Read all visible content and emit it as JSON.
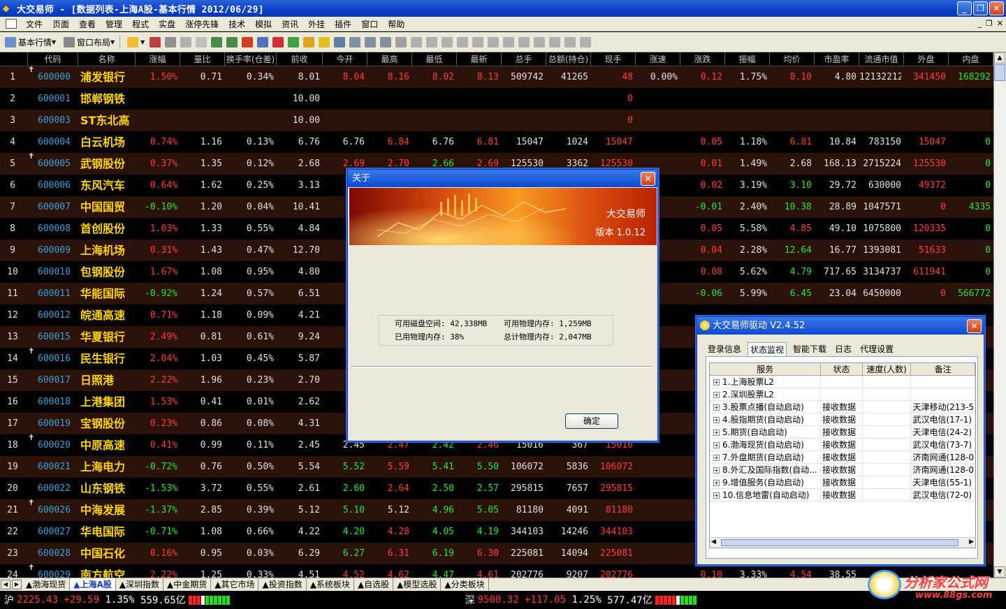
{
  "window": {
    "title": "大交易师 - [数据列表-上海A股-基本行情 2012/06/29]"
  },
  "menu": [
    "文件",
    "页面",
    "查看",
    "管理",
    "程式",
    "实盘",
    "涨停先锋",
    "技术",
    "模拟",
    "资讯",
    "外挂",
    "插件",
    "窗口",
    "帮助"
  ],
  "toolbar": {
    "basic_quote": "基本行情",
    "window_layout": "窗口布局"
  },
  "columns": [
    "",
    "代码",
    "名称",
    "涨幅",
    "量比",
    "换手率(仓差)",
    "前收",
    "今开",
    "最高",
    "最低",
    "最新",
    "总手",
    "总额(持仓)",
    "现手",
    "涨速",
    "涨跌",
    "振幅",
    "均价",
    "市盈率",
    "流通市值",
    "外盘",
    "内盘"
  ],
  "rows": [
    {
      "n": "1",
      "pin": true,
      "code": "600000",
      "name": "浦发银行",
      "chg": "1.50%",
      "vr": "0.71",
      "tr": "0.34%",
      "pc": "8.01",
      "op": "8.04",
      "hi": "8.16",
      "lo": "8.02",
      "la": "8.13",
      "vol": "509742",
      "amt": "41265",
      "cur": "48",
      "spd": "0.00%",
      "d": "0.12",
      "amp": "1.75%",
      "avg": "8.10",
      "pe": "4.80",
      "mv": "12132212",
      "ob": "341450",
      "ib": "168292"
    },
    {
      "n": "2",
      "pin": false,
      "code": "600001",
      "name": "邯郸钢铁",
      "chg": "",
      "vr": "",
      "tr": "",
      "pc": "10.00",
      "op": "",
      "hi": "",
      "lo": "",
      "la": "",
      "vol": "",
      "amt": "",
      "cur": "0",
      "spd": "",
      "d": "",
      "amp": "",
      "avg": "",
      "pe": "",
      "mv": "",
      "ob": "",
      "ib": ""
    },
    {
      "n": "3",
      "pin": false,
      "code": "600003",
      "name": "ST东北高",
      "chg": "",
      "vr": "",
      "tr": "",
      "pc": "10.00",
      "op": "",
      "hi": "",
      "lo": "",
      "la": "",
      "vol": "",
      "amt": "",
      "cur": "0",
      "spd": "",
      "d": "",
      "amp": "",
      "avg": "",
      "pe": "",
      "mv": "",
      "ob": "",
      "ib": ""
    },
    {
      "n": "4",
      "pin": false,
      "code": "600004",
      "name": "白云机场",
      "chg": "0.74%",
      "vr": "1.16",
      "tr": "0.13%",
      "pc": "6.76",
      "op": "6.76",
      "hi": "6.84",
      "lo": "6.76",
      "la": "6.81",
      "vol": "15047",
      "amt": "1024",
      "cur": "15047",
      "spd": "",
      "d": "0.05",
      "amp": "1.18%",
      "avg": "6.81",
      "pe": "10.84",
      "mv": "783150",
      "ob": "15047",
      "ib": "0"
    },
    {
      "n": "5",
      "pin": true,
      "code": "600005",
      "name": "武钢股份",
      "chg": "0.37%",
      "vr": "1.35",
      "tr": "0.12%",
      "pc": "2.68",
      "op": "2.69",
      "hi": "2.70",
      "lo": "2.66",
      "la": "2.69",
      "vol": "125530",
      "amt": "3362",
      "cur": "125530",
      "spd": "",
      "d": "0.01",
      "amp": "1.49%",
      "avg": "2.68",
      "pe": "168.13",
      "mv": "2715224",
      "ob": "125530",
      "ib": "0"
    },
    {
      "n": "6",
      "pin": false,
      "code": "600006",
      "name": "东风汽车",
      "chg": "0.64%",
      "vr": "1.62",
      "tr": "0.25%",
      "pc": "3.13",
      "op": "",
      "hi": "",
      "lo": "",
      "la": "",
      "vol": "",
      "amt": "",
      "cur": "",
      "spd": "",
      "d": "0.02",
      "amp": "3.19%",
      "avg": "3.10",
      "pe": "29.72",
      "mv": "630000",
      "ob": "49372",
      "ib": "0"
    },
    {
      "n": "7",
      "pin": false,
      "code": "600007",
      "name": "中国国贸",
      "chg": "-0.10%",
      "vr": "1.20",
      "tr": "0.04%",
      "pc": "10.41",
      "op": "1",
      "hi": "",
      "lo": "",
      "la": "",
      "vol": "",
      "amt": "",
      "cur": "",
      "spd": "",
      "d": "-0.01",
      "amp": "2.40%",
      "avg": "10.38",
      "pe": "28.89",
      "mv": "1047571",
      "ob": "0",
      "ib": "4335"
    },
    {
      "n": "8",
      "pin": false,
      "code": "600008",
      "name": "首创股份",
      "chg": "1.03%",
      "vr": "1.33",
      "tr": "0.55%",
      "pc": "4.84",
      "op": "",
      "hi": "",
      "lo": "",
      "la": "",
      "vol": "",
      "amt": "",
      "cur": "",
      "spd": "",
      "d": "0.05",
      "amp": "5.58%",
      "avg": "4.85",
      "pe": "49.10",
      "mv": "1075800",
      "ob": "120335",
      "ib": "0"
    },
    {
      "n": "9",
      "pin": false,
      "code": "600009",
      "name": "上海机场",
      "chg": "0.31%",
      "vr": "1.43",
      "tr": "0.47%",
      "pc": "12.70",
      "op": "1",
      "hi": "",
      "lo": "",
      "la": "",
      "vol": "",
      "amt": "",
      "cur": "",
      "spd": "",
      "d": "0.04",
      "amp": "2.28%",
      "avg": "12.64",
      "pe": "16.77",
      "mv": "1393081",
      "ob": "51633",
      "ib": "0"
    },
    {
      "n": "10",
      "pin": false,
      "code": "600010",
      "name": "包钢股份",
      "chg": "1.67%",
      "vr": "1.08",
      "tr": "0.95%",
      "pc": "4.80",
      "op": "",
      "hi": "",
      "lo": "",
      "la": "",
      "vol": "",
      "amt": "",
      "cur": "",
      "spd": "",
      "d": "0.08",
      "amp": "5.62%",
      "avg": "4.79",
      "pe": "717.65",
      "mv": "3134737",
      "ob": "611941",
      "ib": "0"
    },
    {
      "n": "11",
      "pin": false,
      "code": "600011",
      "name": "华能国际",
      "chg": "-0.92%",
      "vr": "1.24",
      "tr": "0.57%",
      "pc": "6.51",
      "op": "",
      "hi": "",
      "lo": "",
      "la": "",
      "vol": "",
      "amt": "",
      "cur": "",
      "spd": "",
      "d": "-0.06",
      "amp": "5.99%",
      "avg": "6.45",
      "pe": "23.04",
      "mv": "6450000",
      "ob": "0",
      "ib": "566772"
    },
    {
      "n": "12",
      "pin": false,
      "code": "600012",
      "name": "皖通高速",
      "chg": "0.71%",
      "vr": "1.18",
      "tr": "0.09%",
      "pc": "4.21",
      "op": "",
      "hi": "",
      "lo": "",
      "la": "",
      "vol": "",
      "amt": "",
      "cur": "",
      "spd": "",
      "d": "",
      "amp": "",
      "avg": "",
      "pe": "",
      "mv": "",
      "ob": "",
      "ib": ""
    },
    {
      "n": "13",
      "pin": false,
      "code": "600015",
      "name": "华夏银行",
      "chg": "2.49%",
      "vr": "0.81",
      "tr": "0.61%",
      "pc": "9.24",
      "op": "",
      "hi": "",
      "lo": "",
      "la": "",
      "vol": "",
      "amt": "",
      "cur": "",
      "spd": "",
      "d": "",
      "amp": "",
      "avg": "",
      "pe": "",
      "mv": "",
      "ob": "",
      "ib": ""
    },
    {
      "n": "14",
      "pin": true,
      "code": "600016",
      "name": "民生银行",
      "chg": "2.04%",
      "vr": "1.03",
      "tr": "0.45%",
      "pc": "5.87",
      "op": "",
      "hi": "",
      "lo": "",
      "la": "",
      "vol": "",
      "amt": "",
      "cur": "",
      "spd": "",
      "d": "",
      "amp": "",
      "avg": "",
      "pe": "",
      "mv": "",
      "ob": "",
      "ib": ""
    },
    {
      "n": "15",
      "pin": false,
      "code": "600017",
      "name": "日照港",
      "chg": "2.22%",
      "vr": "1.96",
      "tr": "0.23%",
      "pc": "2.70",
      "op": "",
      "hi": "",
      "lo": "",
      "la": "",
      "vol": "",
      "amt": "",
      "cur": "",
      "spd": "",
      "d": "",
      "amp": "",
      "avg": "",
      "pe": "",
      "mv": "",
      "ob": "",
      "ib": ""
    },
    {
      "n": "16",
      "pin": false,
      "code": "600018",
      "name": "上港集团",
      "chg": "1.53%",
      "vr": "0.41",
      "tr": "0.01%",
      "pc": "2.62",
      "op": "",
      "hi": "",
      "lo": "",
      "la": "",
      "vol": "",
      "amt": "",
      "cur": "",
      "spd": "",
      "d": "",
      "amp": "",
      "avg": "",
      "pe": "",
      "mv": "",
      "ob": "",
      "ib": ""
    },
    {
      "n": "17",
      "pin": false,
      "code": "600019",
      "name": "宝钢股份",
      "chg": "0.23%",
      "vr": "0.86",
      "tr": "0.08%",
      "pc": "4.31",
      "op": "",
      "hi": "",
      "lo": "",
      "la": "",
      "vol": "",
      "amt": "",
      "cur": "",
      "spd": "",
      "d": "",
      "amp": "",
      "avg": "",
      "pe": "",
      "mv": "",
      "ob": "",
      "ib": ""
    },
    {
      "n": "18",
      "pin": true,
      "code": "600020",
      "name": "中原高速",
      "chg": "0.41%",
      "vr": "0.99",
      "tr": "0.11%",
      "pc": "2.45",
      "op": "2.45",
      "hi": "2.47",
      "lo": "2.42",
      "la": "2.46",
      "vol": "15016",
      "amt": "367",
      "cur": "15016",
      "spd": "",
      "d": "",
      "amp": "",
      "avg": "",
      "pe": "",
      "mv": "",
      "ob": "",
      "ib": ""
    },
    {
      "n": "19",
      "pin": false,
      "code": "600021",
      "name": "上海电力",
      "chg": "-0.72%",
      "vr": "0.76",
      "tr": "0.50%",
      "pc": "5.54",
      "op": "5.52",
      "hi": "5.59",
      "lo": "5.41",
      "la": "5.50",
      "vol": "106072",
      "amt": "5836",
      "cur": "106072",
      "spd": "",
      "d": "",
      "amp": "",
      "avg": "",
      "pe": "",
      "mv": "",
      "ob": "",
      "ib": ""
    },
    {
      "n": "20",
      "pin": false,
      "code": "600022",
      "name": "山东钢铁",
      "chg": "-1.53%",
      "vr": "3.72",
      "tr": "0.55%",
      "pc": "2.61",
      "op": "2.60",
      "hi": "2.64",
      "lo": "2.50",
      "la": "2.57",
      "vol": "295815",
      "amt": "7657",
      "cur": "295815",
      "spd": "",
      "d": "",
      "amp": "",
      "avg": "",
      "pe": "",
      "mv": "",
      "ob": "",
      "ib": ""
    },
    {
      "n": "21",
      "pin": true,
      "code": "600026",
      "name": "中海发展",
      "chg": "-1.37%",
      "vr": "2.85",
      "tr": "0.39%",
      "pc": "5.12",
      "op": "5.10",
      "hi": "5.12",
      "lo": "4.96",
      "la": "5.05",
      "vol": "81180",
      "amt": "4091",
      "cur": "81180",
      "spd": "",
      "d": "",
      "amp": "",
      "avg": "",
      "pe": "",
      "mv": "",
      "ob": "",
      "ib": ""
    },
    {
      "n": "22",
      "pin": false,
      "code": "600027",
      "name": "华电国际",
      "chg": "-0.71%",
      "vr": "1.08",
      "tr": "0.66%",
      "pc": "4.22",
      "op": "4.20",
      "hi": "4.28",
      "lo": "4.05",
      "la": "4.19",
      "vol": "344103",
      "amt": "14246",
      "cur": "344103",
      "spd": "",
      "d": "",
      "amp": "",
      "avg": "",
      "pe": "",
      "mv": "",
      "ob": "",
      "ib": ""
    },
    {
      "n": "23",
      "pin": false,
      "code": "600028",
      "name": "中国石化",
      "chg": "0.16%",
      "vr": "0.95",
      "tr": "0.03%",
      "pc": "6.29",
      "op": "6.27",
      "hi": "6.31",
      "lo": "6.19",
      "la": "6.30",
      "vol": "225081",
      "amt": "14094",
      "cur": "225081",
      "spd": "",
      "d": "",
      "amp": "",
      "avg": "",
      "pe": "",
      "mv": "",
      "ob": "",
      "ib": ""
    },
    {
      "n": "24",
      "pin": true,
      "code": "600029",
      "name": "南方航空",
      "chg": "2.22%",
      "vr": "1.25",
      "tr": "0.33%",
      "pc": "4.51",
      "op": "4.52",
      "hi": "4.62",
      "lo": "4.47",
      "la": "4.61",
      "vol": "202776",
      "amt": "9207",
      "cur": "202776",
      "spd": "",
      "d": "0.10",
      "amp": "3.33%",
      "avg": "4.54",
      "pe": "38.55",
      "mv": "",
      "ob": "",
      "ib": ""
    }
  ],
  "tabs": [
    "▲渤海现货",
    "▲上海A股",
    "▲深圳指数",
    "▲中金期货",
    "▲其它市场",
    "▲投资指数",
    "▲系统板块",
    "▲自选股",
    "▲模型选股",
    "▲分类板块"
  ],
  "active_tab": "▲上海A股",
  "status": {
    "sh_label": "沪",
    "sh_idx": "2225.43",
    "sh_chg": "+29.59",
    "sh_pct": "1.35%",
    "sh_amt": "559.65亿",
    "sz_label": "深",
    "sz_idx": "9500.32",
    "sz_chg": "+117.05",
    "sz_pct": "1.25%",
    "sz_amt": "577.47亿"
  },
  "watermark": {
    "title": "分析家公式网",
    "url": "www.88gs.com"
  },
  "about": {
    "title": "关于",
    "product": "大交易师",
    "version": "版本 1.0.12",
    "disk_label": "可用磁盘空间:",
    "disk": "42,338MB",
    "avail_mem_label": "可用物理内存:",
    "avail_mem": "1,259MB",
    "used_mem_label": "已用物理内存:",
    "used_mem": "38%",
    "total_mem_label": "总计物理内存:",
    "total_mem": "2,047MB",
    "ok": "确定"
  },
  "driver": {
    "title": "大交易师驱动 V2.4.52",
    "tabs": [
      "登录信息",
      "状态监视",
      "智能下载",
      "日志",
      "代理设置"
    ],
    "active_tab": "状态监视",
    "headers": [
      "服务",
      "状态",
      "速度(人数)",
      "备注"
    ],
    "rows": [
      {
        "svc": "1.上海股票L2",
        "st": "",
        "sp": "",
        "note": ""
      },
      {
        "svc": "2.深圳股票L2",
        "st": "",
        "sp": "",
        "note": ""
      },
      {
        "svc": "3.股票点播(自动启动)",
        "st": "接收数据",
        "sp": "",
        "note": "天津移动(213-5)"
      },
      {
        "svc": "4.股指期货(自动启动)",
        "st": "接收数据",
        "sp": "",
        "note": "武汉电信(17-1)"
      },
      {
        "svc": "5.期货(自动启动)",
        "st": "接收数据",
        "sp": "",
        "note": "天津电信(24-2)"
      },
      {
        "svc": "6.渤海现货(自动启动)",
        "st": "接收数据",
        "sp": "",
        "note": "武汉电信(73-7)"
      },
      {
        "svc": "7.外盘期货(自动启动)",
        "st": "接收数据",
        "sp": "",
        "note": "济南网通(128-0)"
      },
      {
        "svc": "8.外汇及国际指数(自动...",
        "st": "接收数据",
        "sp": "",
        "note": "济南网通(128-0)"
      },
      {
        "svc": "9.增值服务(自动启动)",
        "st": "接收数据",
        "sp": "",
        "note": "天津电信(55-1)"
      },
      {
        "svc": "10.信息地雷(自动启动)",
        "st": "接收数据",
        "sp": "",
        "note": "武汉电信(72-0)"
      }
    ]
  },
  "colors": {
    "up": "#ff3c3c",
    "down": "#29e629",
    "name": "#ffd400",
    "code": "#3f9fd8",
    "row_alt": "#2a1208",
    "title_blue": "#0a40c8"
  }
}
